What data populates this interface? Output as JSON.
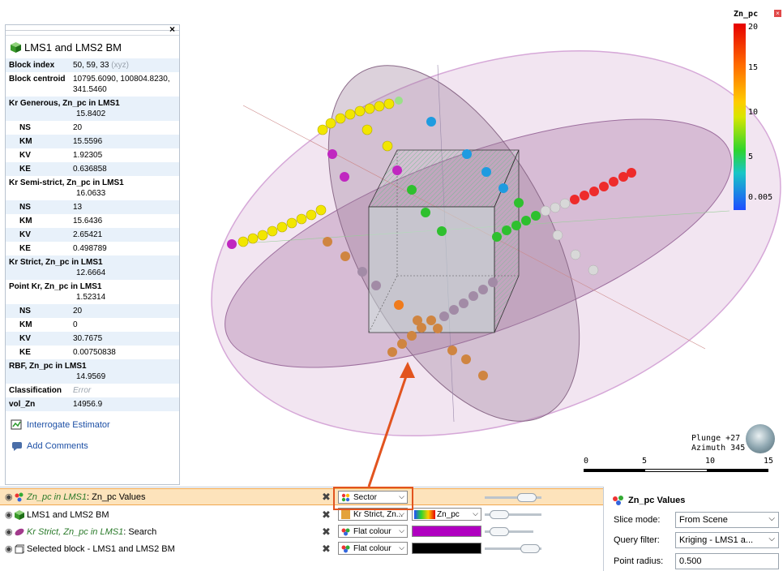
{
  "panel": {
    "title": "LMS1 and LMS2 BM",
    "close": "×",
    "block_index": {
      "label": "Block index",
      "value": "50, 59, 33",
      "suffix": "(xyz)"
    },
    "block_centroid": {
      "label": "Block centroid",
      "value": "10795.6090, 100804.8230,",
      "value2": "341.5460"
    },
    "kr_generous": {
      "label": "Kr Generous, Zn_pc in LMS1",
      "value": "15.8402",
      "rows": [
        {
          "k": "NS",
          "v": "20"
        },
        {
          "k": "KM",
          "v": "15.5596"
        },
        {
          "k": "KV",
          "v": "1.92305"
        },
        {
          "k": "KE",
          "v": "0.636858"
        }
      ]
    },
    "kr_semi": {
      "label": "Kr Semi-strict, Zn_pc in LMS1",
      "value": "16.0633",
      "rows": [
        {
          "k": "NS",
          "v": "13"
        },
        {
          "k": "KM",
          "v": "15.6436"
        },
        {
          "k": "KV",
          "v": "2.65421"
        },
        {
          "k": "KE",
          "v": "0.498789"
        }
      ]
    },
    "kr_strict": {
      "label": "Kr Strict, Zn_pc in LMS1",
      "value": "12.6664"
    },
    "point_kr": {
      "label": "Point Kr, Zn_pc in LMS1",
      "value": "1.52314",
      "rows": [
        {
          "k": "NS",
          "v": "20"
        },
        {
          "k": "KM",
          "v": "0"
        },
        {
          "k": "KV",
          "v": "30.7675"
        },
        {
          "k": "KE",
          "v": "0.00750838"
        }
      ]
    },
    "rbf": {
      "label": "RBF, Zn_pc in LMS1",
      "value": "14.9569"
    },
    "classification": {
      "label": "Classification",
      "value": "Error"
    },
    "vol_zn": {
      "label": "vol_Zn",
      "value": "14956.9"
    },
    "interrogate": "Interrogate Estimator",
    "add_comments": "Add Comments"
  },
  "legend": {
    "title": "Zn_pc",
    "ticks": [
      "20",
      "15",
      "10",
      "5",
      "0.005"
    ],
    "colors": {
      "top": "#e60000",
      "mid": "#ffcc00",
      "low": "#2ed42e",
      "bottom": "#1f4dff"
    }
  },
  "orientation": {
    "plunge": "Plunge +27",
    "azimuth": "Azimuth 345"
  },
  "scale": {
    "labels": [
      "0",
      "5",
      "10",
      "15"
    ]
  },
  "scene_list": [
    {
      "name_italic": "Zn_pc in LMS1",
      "name_rest": ": Zn_pc Values",
      "dropdown": "Sector",
      "selected": true
    },
    {
      "name_italic": "",
      "name_rest": "LMS1 and LMS2 BM",
      "dropdown": "Kr Strict, Zn...",
      "colormap": "Zn_pc",
      "selected": false
    },
    {
      "name_italic": "Kr Strict, Zn_pc in LMS1",
      "name_rest": ": Search",
      "dropdown": "Flat colour",
      "swatch": "#b000c0",
      "selected": false
    },
    {
      "name_italic": "",
      "name_rest": "Selected block - LMS1 and LMS2 BM",
      "dropdown": "Flat colour",
      "swatch": "#000000",
      "selected": false
    }
  ],
  "properties": {
    "title": "Zn_pc Values",
    "slice_mode": {
      "label": "Slice mode:",
      "value": "From Scene"
    },
    "query_filter": {
      "label": "Query filter:",
      "value": "Kriging - LMS1 a..."
    },
    "point_radius": {
      "label": "Point radius:",
      "value": "0.500"
    }
  },
  "icons": [
    "cube-icon",
    "eye-icon",
    "delete-icon",
    "interrogate-icon",
    "comment-icon",
    "globe-icon",
    "dropdown-arrow-icon"
  ]
}
